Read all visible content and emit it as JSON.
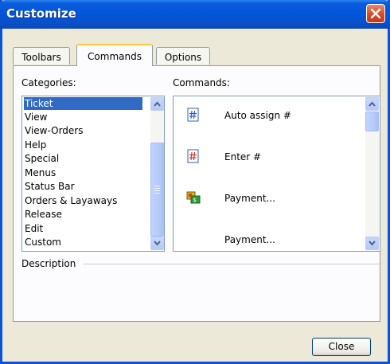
{
  "window": {
    "title": "Customize"
  },
  "tabs": [
    {
      "label": "Toolbars"
    },
    {
      "label": "Commands"
    },
    {
      "label": "Options"
    }
  ],
  "categories": {
    "label": "Categories:",
    "items": [
      "Ticket",
      "View",
      "View-Orders",
      "Help",
      "Special",
      "Menus",
      "Status Bar",
      "Orders & Layaways",
      "Release",
      "Edit",
      "Custom"
    ],
    "selected": "Ticket"
  },
  "commands": {
    "label": "Commands:",
    "items": [
      {
        "label": "Auto assign #",
        "icon": "hash-blue-icon"
      },
      {
        "label": "Enter #",
        "icon": "hash-red-icon"
      },
      {
        "label": "Payment...",
        "icon": "payment-money-icon"
      },
      {
        "label": "Payment...",
        "icon": ""
      }
    ]
  },
  "description": {
    "label": "Description"
  },
  "buttons": {
    "close": "Close"
  },
  "colors": {
    "title_bar": "#0255d8",
    "selection": "#316ac5",
    "tab_highlight": "#ffc83c"
  }
}
